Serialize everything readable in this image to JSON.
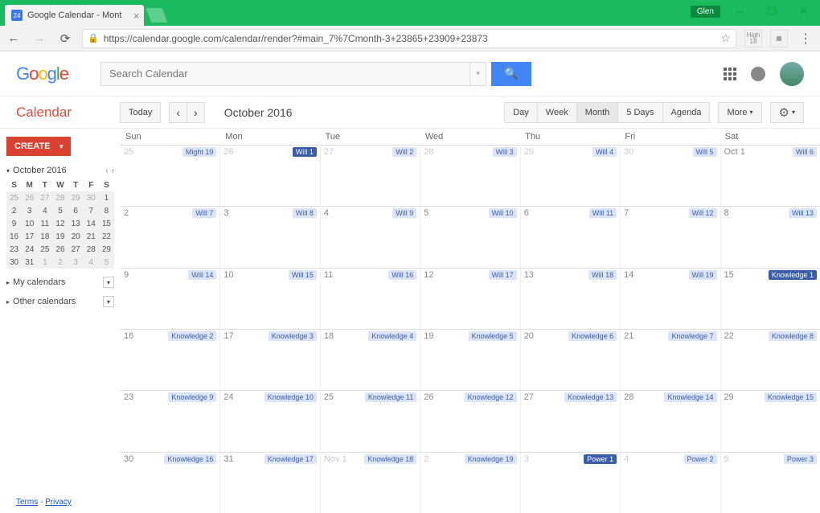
{
  "browser": {
    "tab_title": "Google Calendar - Mont",
    "favicon_text": "24",
    "user_badge": "Glen",
    "url": "https://calendar.google.com/calendar/render?#main_7%7Cmonth-3+23865+23909+23873",
    "ext_label_top": "High",
    "ext_label_bottom": "18"
  },
  "header": {
    "logo_letters": [
      "G",
      "o",
      "o",
      "g",
      "l",
      "e"
    ],
    "search_placeholder": "Search Calendar"
  },
  "toolbar": {
    "app_name": "Calendar",
    "today": "Today",
    "period": "October 2016",
    "views": [
      "Day",
      "Week",
      "Month",
      "5 Days",
      "Agenda"
    ],
    "active_view": 2,
    "more": "More"
  },
  "sidebar": {
    "create": "CREATE",
    "mini_month": "October 2016",
    "dow": [
      "S",
      "M",
      "T",
      "W",
      "T",
      "F",
      "S"
    ],
    "weeks": [
      [
        {
          "n": "25",
          "o": 1
        },
        {
          "n": "26",
          "o": 1
        },
        {
          "n": "27",
          "o": 1
        },
        {
          "n": "28",
          "o": 1
        },
        {
          "n": "29",
          "o": 1
        },
        {
          "n": "30",
          "o": 1
        },
        {
          "n": "1"
        }
      ],
      [
        {
          "n": "2"
        },
        {
          "n": "3"
        },
        {
          "n": "4"
        },
        {
          "n": "5"
        },
        {
          "n": "6"
        },
        {
          "n": "7"
        },
        {
          "n": "8"
        }
      ],
      [
        {
          "n": "9"
        },
        {
          "n": "10"
        },
        {
          "n": "11"
        },
        {
          "n": "12"
        },
        {
          "n": "13"
        },
        {
          "n": "14"
        },
        {
          "n": "15"
        }
      ],
      [
        {
          "n": "16"
        },
        {
          "n": "17"
        },
        {
          "n": "18"
        },
        {
          "n": "19"
        },
        {
          "n": "20"
        },
        {
          "n": "21"
        },
        {
          "n": "22"
        }
      ],
      [
        {
          "n": "23"
        },
        {
          "n": "24"
        },
        {
          "n": "25"
        },
        {
          "n": "26"
        },
        {
          "n": "27"
        },
        {
          "n": "28"
        },
        {
          "n": "29"
        }
      ],
      [
        {
          "n": "30"
        },
        {
          "n": "31"
        },
        {
          "n": "1",
          "o": 1
        },
        {
          "n": "2",
          "o": 1
        },
        {
          "n": "3",
          "o": 1
        },
        {
          "n": "4",
          "o": 1
        },
        {
          "n": "5",
          "o": 1
        }
      ]
    ],
    "my_calendars": "My calendars",
    "other_calendars": "Other calendars"
  },
  "grid": {
    "dow": [
      "Sun",
      "Mon",
      "Tue",
      "Wed",
      "Thu",
      "Fri",
      "Sat"
    ],
    "weeks": [
      [
        {
          "num": "25",
          "other": 1,
          "event": "Might 19"
        },
        {
          "num": "26",
          "other": 1,
          "event": "Will 1",
          "solid": 1
        },
        {
          "num": "27",
          "other": 1,
          "event": "Will 2"
        },
        {
          "num": "28",
          "other": 1,
          "event": "Will 3"
        },
        {
          "num": "29",
          "other": 1,
          "event": "Will 4"
        },
        {
          "num": "30",
          "other": 1,
          "event": "Will 5"
        },
        {
          "num": "Oct 1",
          "event": "Will 6"
        }
      ],
      [
        {
          "num": "2",
          "event": "Will 7"
        },
        {
          "num": "3",
          "event": "Will 8"
        },
        {
          "num": "4",
          "event": "Will 9"
        },
        {
          "num": "5",
          "event": "Will 10"
        },
        {
          "num": "6",
          "event": "Will 11"
        },
        {
          "num": "7",
          "event": "Will 12"
        },
        {
          "num": "8",
          "event": "Will 13"
        }
      ],
      [
        {
          "num": "9",
          "event": "Will 14"
        },
        {
          "num": "10",
          "event": "Will 15"
        },
        {
          "num": "11",
          "event": "Will 16"
        },
        {
          "num": "12",
          "event": "Will 17"
        },
        {
          "num": "13",
          "event": "Will 18"
        },
        {
          "num": "14",
          "event": "Will 19"
        },
        {
          "num": "15",
          "event": "Knowledge 1",
          "solid": 1
        }
      ],
      [
        {
          "num": "16",
          "event": "Knowledge 2"
        },
        {
          "num": "17",
          "event": "Knowledge 3"
        },
        {
          "num": "18",
          "event": "Knowledge 4"
        },
        {
          "num": "19",
          "event": "Knowledge 5"
        },
        {
          "num": "20",
          "event": "Knowledge 6"
        },
        {
          "num": "21",
          "event": "Knowledge 7"
        },
        {
          "num": "22",
          "event": "Knowledge 8"
        }
      ],
      [
        {
          "num": "23",
          "event": "Knowledge 9"
        },
        {
          "num": "24",
          "event": "Knowledge 10"
        },
        {
          "num": "25",
          "event": "Knowledge 11"
        },
        {
          "num": "26",
          "event": "Knowledge 12"
        },
        {
          "num": "27",
          "event": "Knowledge 13"
        },
        {
          "num": "28",
          "event": "Knowledge 14"
        },
        {
          "num": "29",
          "event": "Knowledge 15"
        }
      ],
      [
        {
          "num": "30",
          "event": "Knowledge 16"
        },
        {
          "num": "31",
          "event": "Knowledge 17"
        },
        {
          "num": "Nov 1",
          "other": 1,
          "event": "Knowledge 18"
        },
        {
          "num": "2",
          "other": 1,
          "event": "Knowledge 19"
        },
        {
          "num": "3",
          "other": 1,
          "event": "Power 1",
          "solid": 1
        },
        {
          "num": "4",
          "other": 1,
          "event": "Power 2"
        },
        {
          "num": "5",
          "other": 1,
          "event": "Power 3"
        }
      ]
    ]
  },
  "footer": {
    "terms": "Terms",
    "privacy": "Privacy"
  }
}
